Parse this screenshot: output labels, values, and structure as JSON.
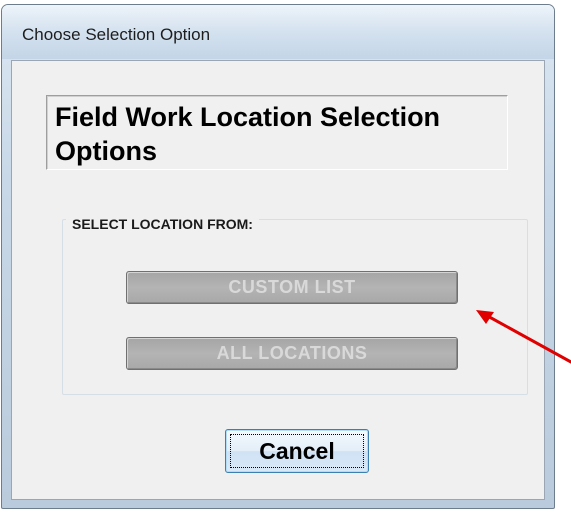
{
  "window": {
    "title": "Choose Selection Option"
  },
  "dialog": {
    "heading": "Field Work Location Selection Options",
    "group_label": "SELECT LOCATION FROM:",
    "buttons": {
      "custom_list": "CUSTOM LIST",
      "all_locations": "ALL LOCATIONS",
      "cancel": "Cancel"
    },
    "state": {
      "custom_list_enabled": false,
      "all_locations_enabled": false,
      "focused_button": "cancel"
    }
  },
  "annotation": {
    "icon": "red-arrow-icon",
    "color": "#e00000"
  },
  "colors": {
    "disabled_button_bg": "#aaaaaa",
    "disabled_button_text": "#d9d9d9",
    "focus_button_border": "#3c7fb1"
  }
}
